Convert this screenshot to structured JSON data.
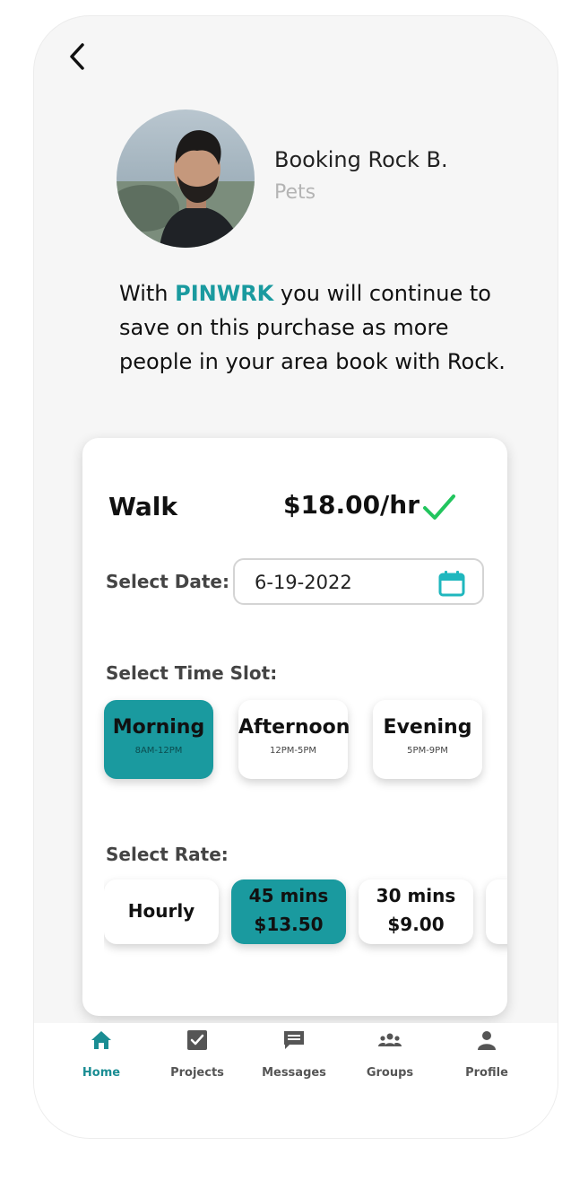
{
  "colors": {
    "accent": "#1a9a9f",
    "check": "#22c55e",
    "muted_text": "#b4b4b4"
  },
  "header": {
    "back_icon": "chevron-left-icon"
  },
  "provider": {
    "name": "Booking Rock B.",
    "category": "Pets"
  },
  "promo": {
    "prefix": "With ",
    "brand": "PINWRK",
    "suffix": " you will continue to save on this purchase as more people in your area book with Rock."
  },
  "booking": {
    "service": "Walk",
    "price": "$18.00/hr",
    "selected_icon": "check-icon",
    "date_label": "Select Date:",
    "date_value": "6-19-2022",
    "date_icon": "calendar-icon",
    "time_label": "Select Time Slot:",
    "time_slots": [
      {
        "title": "Morning",
        "range": "8AM-12PM",
        "selected": true
      },
      {
        "title": "Afternoon",
        "range": "12PM-5PM",
        "selected": false
      },
      {
        "title": "Evening",
        "range": "5PM-9PM",
        "selected": false
      }
    ],
    "rate_label": "Select Rate:",
    "rates": [
      {
        "line1": "Hourly",
        "line2": "",
        "selected": false
      },
      {
        "line1": "45 mins",
        "line2": "$13.50",
        "selected": true
      },
      {
        "line1": "30 mins",
        "line2": "$9.00",
        "selected": false
      }
    ]
  },
  "tabbar": {
    "items": [
      {
        "label": "Home",
        "icon": "home-icon",
        "active": true
      },
      {
        "label": "Projects",
        "icon": "checkbox-icon",
        "active": false
      },
      {
        "label": "Messages",
        "icon": "message-icon",
        "active": false
      },
      {
        "label": "Groups",
        "icon": "groups-icon",
        "active": false
      },
      {
        "label": "Profile",
        "icon": "person-icon",
        "active": false
      }
    ]
  }
}
